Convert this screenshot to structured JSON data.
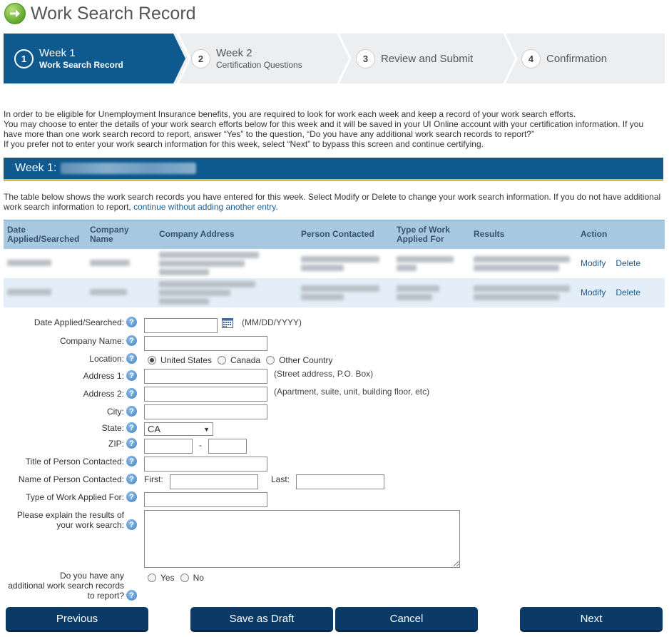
{
  "header": {
    "title": "Work Search Record",
    "icon": "arrow-right-icon"
  },
  "stepper": {
    "steps": [
      {
        "num": "1",
        "title": "Week 1",
        "sub": "Work Search Record",
        "active": true
      },
      {
        "num": "2",
        "title": "Week 2",
        "sub": "Certification Questions"
      },
      {
        "num": "3",
        "title": "Review and Submit",
        "sub": ""
      },
      {
        "num": "4",
        "title": "Confirmation",
        "sub": ""
      }
    ]
  },
  "intro": {
    "line1": "In order to be eligible for Unemployment Insurance benefits, you are required to look for work each week and keep a record of your work search efforts.",
    "line2": "You may choose to enter the details of your work search efforts below for this week and it will be saved in your UI Online account with your certification information. If you have more than one work search record to report, answer “Yes” to the question, “Do you have any additional work search records to report?”",
    "line3": "If you prefer not to enter your work search information for this week, select “Next” to bypass this screen and continue certifying."
  },
  "week_bar": {
    "label": "Week 1:"
  },
  "desc": {
    "text": "The table below shows the work search records you have entered for this week. Select Modify or Delete to change your work search information. If you do not have additional work search information to report, ",
    "link": "continue without adding another entry."
  },
  "table": {
    "headers": [
      "Date Applied/Searched",
      "Company Name",
      "Company Address",
      "Person Contacted",
      "Type of Work Applied For",
      "Results",
      "Action"
    ],
    "modify_label": "Modify",
    "delete_label": "Delete"
  },
  "form": {
    "date_label": "Date Applied/Searched:",
    "date_hint": "(MM/DD/YYYY)",
    "company_label": "Company Name:",
    "location_label": "Location:",
    "location_options": [
      "United States",
      "Canada",
      "Other Country"
    ],
    "location_selected": "United States",
    "address1_label": "Address 1:",
    "address1_hint": "(Street address, P.O. Box)",
    "address2_label": "Address 2:",
    "address2_hint": "(Apartment, suite, unit, building floor, etc)",
    "city_label": "City:",
    "state_label": "State:",
    "state_value": "CA",
    "zip_label": "ZIP:",
    "zip_sep": "-",
    "title_label": "Title of Person Contacted:",
    "name_label": "Name of Person Contacted:",
    "first_label": "First:",
    "last_label": "Last:",
    "work_type_label": "Type of Work Applied For:",
    "results_label_1": "Please explain the results of",
    "results_label_2": "your work search:",
    "additional_label_1": "Do you have any",
    "additional_label_2": "additional work search records",
    "additional_label_3": "to report?",
    "yes_label": "Yes",
    "no_label": "No"
  },
  "buttons": {
    "previous": "Previous",
    "save_draft": "Save as Draft",
    "cancel": "Cancel",
    "next": "Next"
  },
  "colors": {
    "primary": "#0e5a8f",
    "button": "#0c3a66",
    "accent": "#e2b93b",
    "table_header": "#a6c8e1"
  }
}
